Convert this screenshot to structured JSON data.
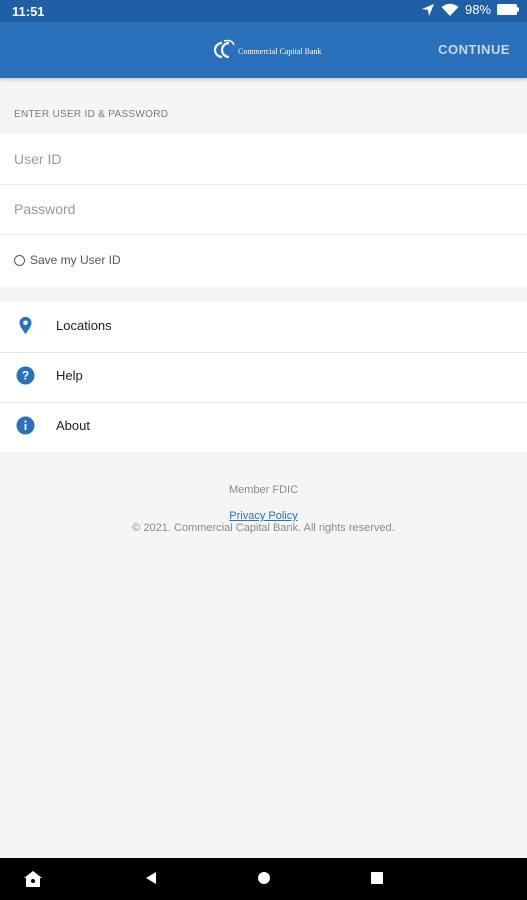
{
  "status_bar": {
    "time": "11:51",
    "battery": "98%"
  },
  "app_bar": {
    "logo_text": "Commercial Capital Bank",
    "continue_label": "CONTINUE"
  },
  "login": {
    "section_label": "ENTER USER ID & PASSWORD",
    "user_id_placeholder": "User ID",
    "password_placeholder": "Password",
    "save_user_id_label": "Save my User ID"
  },
  "menu": {
    "items": [
      {
        "label": "Locations",
        "icon": "location-pin-icon"
      },
      {
        "label": "Help",
        "icon": "help-icon"
      },
      {
        "label": "About",
        "icon": "info-icon"
      }
    ]
  },
  "footer": {
    "member": "Member FDIC",
    "privacy": "Privacy Policy",
    "copyright": "© 2021. Commercial Capital Bank. All rights reserved."
  },
  "colors": {
    "status_bar": "#1e5fa8",
    "app_bar": "#2a70bb",
    "accent": "#2a70bb",
    "background": "#f5f5f5"
  }
}
